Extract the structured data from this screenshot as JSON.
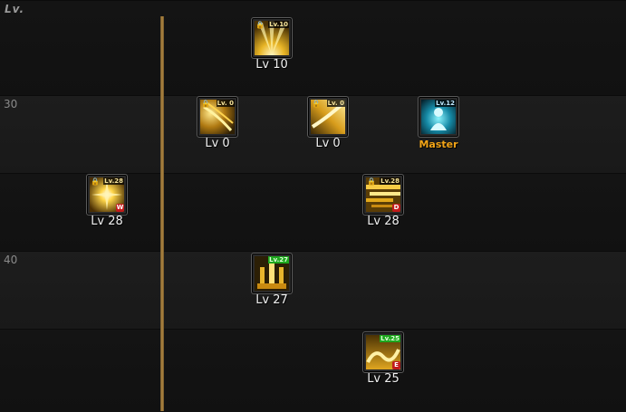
{
  "header": {
    "level_column_label": "Lv."
  },
  "rows": [
    {
      "level_label": ""
    },
    {
      "level_label": "30"
    },
    {
      "level_label": ""
    },
    {
      "level_label": "40"
    },
    {
      "level_label": ""
    }
  ],
  "skills": [
    {
      "id": "s1",
      "row": 0,
      "icon": "golden-rays-icon",
      "locked": true,
      "tag": "Lv.10",
      "tag_style": "yellow",
      "badge": "",
      "caption": "Lv 10"
    },
    {
      "id": "s2",
      "row": 1,
      "icon": "golden-swirl-icon",
      "locked": true,
      "tag": "Lv. 0",
      "tag_style": "yellow",
      "badge": "",
      "caption": "Lv 0"
    },
    {
      "id": "s3",
      "row": 1,
      "icon": "golden-slash-icon",
      "locked": true,
      "tag": "Lv. 0",
      "tag_style": "yellow",
      "badge": "",
      "caption": "Lv 0"
    },
    {
      "id": "s4",
      "row": 1,
      "icon": "aura-figure-icon",
      "locked": false,
      "tag": "Lv.12",
      "tag_style": "blue",
      "badge": "",
      "caption": "Master"
    },
    {
      "id": "s5",
      "row": 2,
      "icon": "golden-burst-icon",
      "locked": true,
      "tag": "Lv.28",
      "tag_style": "yellow",
      "badge": "W",
      "caption": "Lv 28"
    },
    {
      "id": "s6",
      "row": 2,
      "icon": "golden-streaks-icon",
      "locked": true,
      "tag": "Lv.28",
      "tag_style": "yellow",
      "badge": "D",
      "caption": "Lv 28"
    },
    {
      "id": "s7",
      "row": 3,
      "icon": "golden-pillars-icon",
      "locked": false,
      "tag": "Lv.27",
      "tag_style": "green",
      "badge": "",
      "caption": "Lv 27"
    },
    {
      "id": "s8",
      "row": 4,
      "icon": "golden-wave-icon",
      "locked": false,
      "tag": "Lv.25",
      "tag_style": "green",
      "badge": "E",
      "caption": "Lv 25"
    }
  ],
  "colors": {
    "accent_gold": "#b48a44",
    "master_text": "#f2a417",
    "badge_red": "#c11b1b",
    "tag_green": "#1ea71e"
  }
}
